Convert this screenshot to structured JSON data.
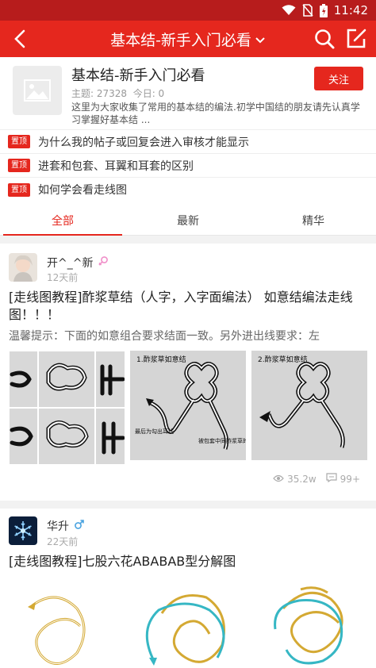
{
  "status_bar": {
    "time": "11:42"
  },
  "app_bar": {
    "title": "基本结-新手入门必看",
    "title_arrow": "⌄"
  },
  "forum": {
    "name": "基本结-新手入门必看",
    "topics_label": "主题: 27328",
    "today_label": "今日: 0",
    "description": "这里为大家收集了常用的基本结的编法.初学中国结的朋友请先认真学习掌握好基本结 ...",
    "follow_label": "关注"
  },
  "pinned_badge": "置顶",
  "pinned": [
    {
      "title": "为什么我的帖子或回复会进入审核才能显示"
    },
    {
      "title": "进套和包套、耳翼和耳套的区别"
    },
    {
      "title": "如何学会看走线图"
    }
  ],
  "tabs": [
    {
      "label": "全部",
      "active": true
    },
    {
      "label": "最新",
      "active": false
    },
    {
      "label": "精华",
      "active": false
    }
  ],
  "posts": [
    {
      "author": "开^_^新",
      "gender_icon": "female-icon",
      "time": "12天前",
      "title": "[走线图教程]酢浆草结（人字，入字面编法） 如意结编法走线图！！！",
      "excerpt": "温馨提示：下面的如意组合要求结面一致。另外进出线要求：左",
      "views": "35.2w",
      "comments": "99+",
      "images": [
        {
          "caption": ""
        },
        {
          "caption": "1.酢浆草如意结"
        },
        {
          "caption": "2.酢浆草如意结"
        }
      ],
      "image_notes": [
        "最后为勾出耳线",
        "被包套中同酢浆草的线"
      ]
    },
    {
      "author": "华升",
      "gender_icon": "male-icon",
      "time": "22天前",
      "title": "[走线图教程]七股六花ABABAB型分解图"
    }
  ],
  "colors": {
    "brand": "#e5271e",
    "status": "#b71c1c",
    "female": "#f08fc9",
    "male": "#4aa3e0"
  }
}
